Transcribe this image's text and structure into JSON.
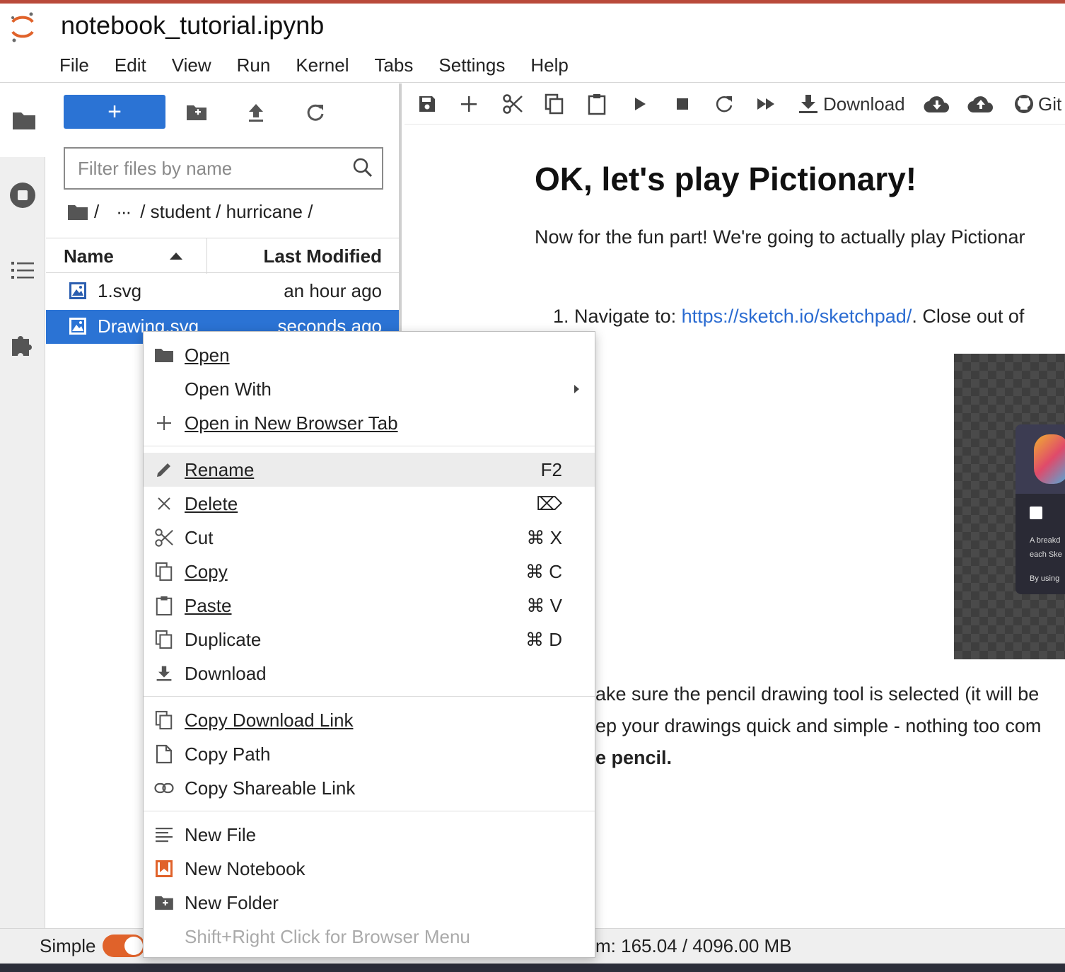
{
  "app": {
    "title": "notebook_tutorial.ipynb",
    "menu": [
      "File",
      "Edit",
      "View",
      "Run",
      "Kernel",
      "Tabs",
      "Settings",
      "Help"
    ]
  },
  "activity_bar": {
    "icons": [
      "folder-icon",
      "stop-circle-icon",
      "list-icon",
      "puzzle-icon"
    ]
  },
  "file_browser": {
    "new_label": "+",
    "filter_placeholder": "Filter files by name",
    "breadcrumb": {
      "sep1": "/",
      "ellipsis": "···",
      "path": "/ student / hurricane /"
    },
    "columns": {
      "name": "Name",
      "modified": "Last Modified"
    },
    "files": [
      {
        "name": "1.svg",
        "modified": "an hour ago",
        "selected": false
      },
      {
        "name": "Drawing.svg",
        "modified": "seconds ago",
        "selected": true
      }
    ]
  },
  "notebook": {
    "toolbar": {
      "download": "Download",
      "git": "Git"
    },
    "heading": "OK, let's play Pictionary!",
    "paragraph": "Now for the fun part! We're going to actually play Pictionar",
    "list_item": {
      "number": "1.",
      "prefix": "Navigate to: ",
      "link": "https://sketch.io/sketchpad/",
      "suffix": ". Close out of"
    },
    "image_caption_lines": [
      "A breakd",
      "each Ske",
      "By using"
    ],
    "text_lines": [
      "ake sure the pencil drawing tool is selected (it will be",
      "ep your drawings quick and simple - nothing too com",
      "e pencil."
    ]
  },
  "status_bar": {
    "mode_label": "Simple",
    "simple_mode_on": true,
    "memory": "m: 165.04 / 4096.00 MB"
  },
  "context_menu": {
    "items": [
      {
        "label": "Open",
        "shortcut": "",
        "icon": "folder-icon"
      },
      {
        "label": "Open With",
        "shortcut": "",
        "icon": ""
      },
      {
        "label": "Open in New Browser Tab",
        "shortcut": "",
        "icon": "plus-icon"
      },
      {
        "label": "Rename",
        "shortcut": "F2",
        "icon": "pencil-icon"
      },
      {
        "label": "Delete",
        "shortcut": "⌦",
        "icon": "close-icon"
      },
      {
        "label": "Cut",
        "shortcut": "⌘ X",
        "icon": "scissors-icon"
      },
      {
        "label": "Copy",
        "shortcut": "⌘ C",
        "icon": "copy-icon"
      },
      {
        "label": "Paste",
        "shortcut": "⌘ V",
        "icon": "clipboard-icon"
      },
      {
        "label": "Duplicate",
        "shortcut": "⌘ D",
        "icon": "copy-icon"
      },
      {
        "label": "Download",
        "shortcut": "",
        "icon": "download-icon"
      },
      {
        "label": "Copy Download Link",
        "shortcut": "",
        "icon": "copy-icon"
      },
      {
        "label": "Copy Path",
        "shortcut": "",
        "icon": "file-icon"
      },
      {
        "label": "Copy Shareable Link",
        "shortcut": "",
        "icon": "link-icon"
      },
      {
        "label": "New File",
        "shortcut": "",
        "icon": "text-file-icon"
      },
      {
        "label": "New Notebook",
        "shortcut": "",
        "icon": "notebook-icon"
      },
      {
        "label": "New Folder",
        "shortcut": "",
        "icon": "new-folder-icon"
      },
      {
        "label": "Shift+Right Click for Browser Menu",
        "shortcut": "",
        "icon": ""
      }
    ]
  },
  "colors": {
    "accent": "#2b73d4",
    "jupyter_orange": "#e0622a",
    "link": "#2a6bd1"
  }
}
